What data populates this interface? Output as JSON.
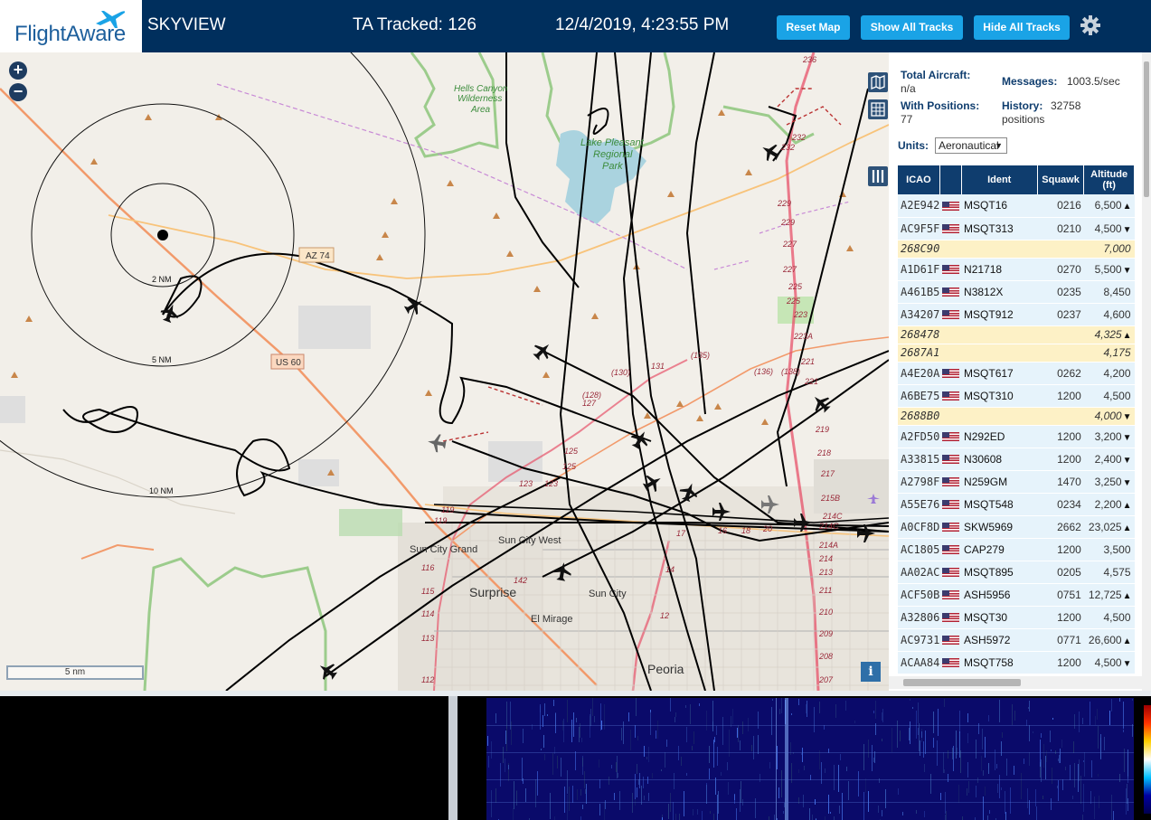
{
  "header": {
    "brand_a": "Flight",
    "brand_b": "Aware",
    "app_name": "SKYVIEW",
    "tracked_label": "TA Tracked: 126",
    "datetime": "12/4/2019, 4:23:55 PM",
    "reset_map": "Reset Map",
    "show_all_tracks": "Show All Tracks",
    "hide_all_tracks": "Hide All Tracks"
  },
  "map": {
    "zoom_in": "+",
    "zoom_out": "−",
    "scale_label": "5 nm",
    "info_label": "i",
    "range_rings": [
      "2 NM",
      "5 NM",
      "10 NM"
    ],
    "place_labels": [
      {
        "text": "Hells Canyon",
        "cls": "park"
      },
      {
        "text": "Wilderness",
        "cls": "park"
      },
      {
        "text": "Area",
        "cls": "park"
      },
      {
        "text": "Lake Pleasant",
        "cls": "water"
      },
      {
        "text": "Regional",
        "cls": "water"
      },
      {
        "text": "Park",
        "cls": "water"
      },
      {
        "text": "Sun City Grand",
        "cls": "town"
      },
      {
        "text": "Sun City West",
        "cls": "town"
      },
      {
        "text": "Surprise",
        "cls": "city"
      },
      {
        "text": "Sun City",
        "cls": "town"
      },
      {
        "text": "El Mirage",
        "cls": "town"
      },
      {
        "text": "Peoria",
        "cls": "city"
      }
    ],
    "road_shields": [
      "AZ 74",
      "US 60"
    ],
    "exit_labels": [
      "236",
      "232",
      "232",
      "229",
      "229",
      "227",
      "227",
      "225",
      "225",
      "223",
      "223A",
      "221",
      "221",
      "219",
      "218",
      "217",
      "215B",
      "214C",
      "214C",
      "214A",
      "214",
      "213",
      "211",
      "210",
      "209",
      "208",
      "207",
      "(138)",
      "(136)",
      "(135)",
      "131",
      "(130)",
      "(128)",
      "127",
      "125",
      "125",
      "123",
      "123",
      "119",
      "119",
      "116",
      "115",
      "114",
      "113",
      "112",
      "142",
      "14",
      "16",
      "17",
      "18",
      "20",
      "12"
    ]
  },
  "panel": {
    "total_aircraft_label": "Total Aircraft:",
    "total_aircraft_value": "n/a",
    "messages_label": "Messages:",
    "messages_value": "1003.5/sec",
    "with_positions_label": "With Positions:",
    "with_positions_value": "77",
    "history_label": "History:",
    "history_value": "32758",
    "history_unit": "positions",
    "units_label": "Units:",
    "units_value": "Aeronautical",
    "columns": {
      "icao": "ICAO",
      "ident": "Ident",
      "squawk": "Squawk",
      "alt1": "Altitude",
      "alt2": "(ft)"
    },
    "rows": [
      {
        "icao": "A2E942",
        "flag": true,
        "ident": "MSQT16",
        "squawk": "0216",
        "alt": "6,500",
        "trend": "▲",
        "noloc": false
      },
      {
        "icao": "AC9F5F",
        "flag": true,
        "ident": "MSQT313",
        "squawk": "0210",
        "alt": "4,500",
        "trend": "▼",
        "noloc": false
      },
      {
        "icao": "268C90",
        "flag": false,
        "ident": "",
        "squawk": "",
        "alt": "7,000",
        "trend": "",
        "noloc": true
      },
      {
        "icao": "A1D61F",
        "flag": true,
        "ident": "N21718",
        "squawk": "0270",
        "alt": "5,500",
        "trend": "▼",
        "noloc": false
      },
      {
        "icao": "A461B5",
        "flag": true,
        "ident": "N3812X",
        "squawk": "0235",
        "alt": "8,450",
        "trend": "",
        "noloc": false
      },
      {
        "icao": "A34207",
        "flag": true,
        "ident": "MSQT912",
        "squawk": "0237",
        "alt": "4,600",
        "trend": "",
        "noloc": false
      },
      {
        "icao": "268478",
        "flag": false,
        "ident": "",
        "squawk": "",
        "alt": "4,325",
        "trend": "▲",
        "noloc": true
      },
      {
        "icao": "2687A1",
        "flag": false,
        "ident": "",
        "squawk": "",
        "alt": "4,175",
        "trend": "",
        "noloc": true
      },
      {
        "icao": "A4E20A",
        "flag": true,
        "ident": "MSQT617",
        "squawk": "0262",
        "alt": "4,200",
        "trend": "",
        "noloc": false
      },
      {
        "icao": "A6BE75",
        "flag": true,
        "ident": "MSQT310",
        "squawk": "1200",
        "alt": "4,500",
        "trend": "",
        "noloc": false
      },
      {
        "icao": "2688B0",
        "flag": false,
        "ident": "",
        "squawk": "",
        "alt": "4,000",
        "trend": "▼",
        "noloc": true
      },
      {
        "icao": "A2FD50",
        "flag": true,
        "ident": "N292ED",
        "squawk": "1200",
        "alt": "3,200",
        "trend": "▼",
        "noloc": false
      },
      {
        "icao": "A33815",
        "flag": true,
        "ident": "N30608",
        "squawk": "1200",
        "alt": "2,400",
        "trend": "▼",
        "noloc": false
      },
      {
        "icao": "A2798F",
        "flag": true,
        "ident": "N259GM",
        "squawk": "1470",
        "alt": "3,250",
        "trend": "▼",
        "noloc": false
      },
      {
        "icao": "A55E76",
        "flag": true,
        "ident": "MSQT548",
        "squawk": "0234",
        "alt": "2,200",
        "trend": "▲",
        "noloc": false
      },
      {
        "icao": "A0CF8D",
        "flag": true,
        "ident": "SKW5969",
        "squawk": "2662",
        "alt": "23,025",
        "trend": "▲",
        "noloc": false
      },
      {
        "icao": "AC1805",
        "flag": true,
        "ident": "CAP279",
        "squawk": "1200",
        "alt": "3,500",
        "trend": "",
        "noloc": false
      },
      {
        "icao": "AA02AC",
        "flag": true,
        "ident": "MSQT895",
        "squawk": "0205",
        "alt": "4,575",
        "trend": "",
        "noloc": false
      },
      {
        "icao": "ACF50B",
        "flag": true,
        "ident": "ASH5956",
        "squawk": "0751",
        "alt": "12,725",
        "trend": "▲",
        "noloc": false
      },
      {
        "icao": "A32806",
        "flag": true,
        "ident": "MSQT30",
        "squawk": "1200",
        "alt": "4,500",
        "trend": "",
        "noloc": false
      },
      {
        "icao": "AC9731",
        "flag": true,
        "ident": "ASH5972",
        "squawk": "0771",
        "alt": "26,600",
        "trend": "▲",
        "noloc": false
      },
      {
        "icao": "ACAA84",
        "flag": true,
        "ident": "MSQT758",
        "squawk": "1200",
        "alt": "4,500",
        "trend": "▼",
        "noloc": false
      }
    ]
  },
  "colors": {
    "header_bg": "#002f5d",
    "button_bg": "#1aa3e6",
    "table_header_bg": "#0f3d6e",
    "row_bg": "#e6f3fb",
    "noloc_row_bg": "#fdf1c6",
    "track_color": "#000000",
    "highway_color": "#e7526a"
  }
}
